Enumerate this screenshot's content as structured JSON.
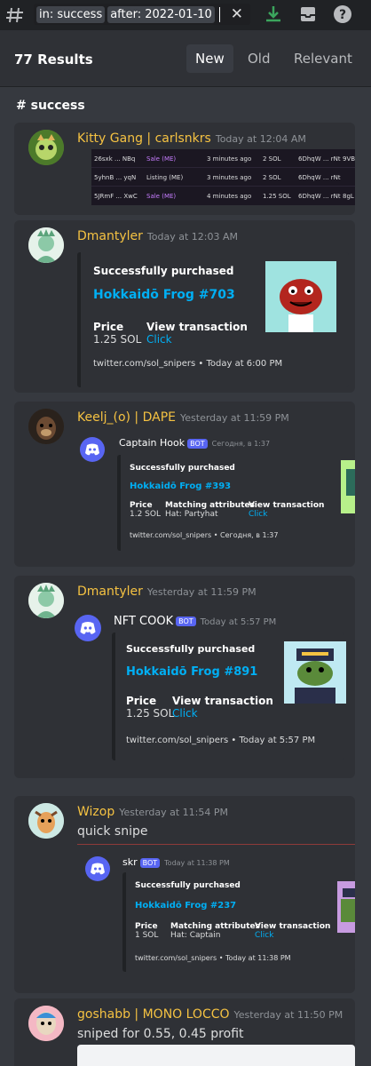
{
  "search": {
    "chip1": "in: success",
    "chip2": "after: 2022-01-10"
  },
  "header": {
    "results": "77 Results",
    "tabs": [
      "New",
      "Old",
      "Relevant"
    ]
  },
  "channel": "# success",
  "msg1": {
    "user": "Kitty Gang | carlsnkrs",
    "time": "Today at 12:04 AM",
    "rows": [
      [
        "26sxk ... NBq",
        "Sale (ME)",
        "3 minutes ago",
        "2 SOL",
        "6DhqW ... rNt",
        "9VB"
      ],
      [
        "5yhnB ... yqN",
        "Listing (ME)",
        "3 minutes ago",
        "2 SOL",
        "6DhqW ... rNt",
        ""
      ],
      [
        "5JRmF ... XwC",
        "Sale (ME)",
        "4 minutes ago",
        "1.25 SOL",
        "6DhqW ... rNt",
        "8gL"
      ]
    ]
  },
  "msg2": {
    "user": "Dmantyler",
    "time": "Today at 12:03 AM",
    "title": "Successfully purchased",
    "link": "Hokkaidō Frog #703",
    "price_label": "Price",
    "price": "1.25 SOL",
    "vt_label": "View transaction",
    "vt": "Click",
    "footer": "twitter.com/sol_snipers • Today at 6:00 PM"
  },
  "msg3": {
    "user": "Keelj_(o) | DAPE",
    "time": "Yesterday at 11:59 PM",
    "bot": "Captain Hook",
    "badge": "BOT",
    "bottime": "Сегодня, в 1:37",
    "title": "Successfully purchased",
    "link": "Hokkaidō Frog #393",
    "price_label": "Price",
    "price": "1.2 SOL",
    "attr_label": "Matching attributes",
    "attr": "Hat: Partyhat",
    "vt_label": "View transaction",
    "vt": "Click",
    "footer": "twitter.com/sol_snipers • Сегодня, в 1:37"
  },
  "msg4": {
    "user": "Dmantyler",
    "time": "Yesterday at 11:59 PM",
    "bot": "NFT COOK",
    "badge": "BOT",
    "bottime": "Today at 5:57 PM",
    "title": "Successfully purchased",
    "link": "Hokkaidō Frog #891",
    "price_label": "Price",
    "price": "1.25 SOL",
    "vt_label": "View transaction",
    "vt": "Click",
    "footer": "twitter.com/sol_snipers • Today at 5:57 PM"
  },
  "msg5": {
    "user": "Wizop",
    "time": "Yesterday at 11:54 PM",
    "text": "quick snipe",
    "bot": "skr",
    "badge": "BOT",
    "bottime": "Today at 11:38 PM",
    "title": "Successfully purchased",
    "link": "Hokkaidō Frog #237",
    "price_label": "Price",
    "price": "1 SOL",
    "attr_label": "Matching attributes",
    "attr": "Hat: Captain",
    "vt_label": "View transaction",
    "vt": "Click",
    "footer": "twitter.com/sol_snipers • Today at 11:38 PM"
  },
  "msg6": {
    "user": "goshabb | MONO LOCCO",
    "time": "Yesterday at 11:50 PM",
    "text": "sniped for 0.55, 0.45 profit"
  },
  "colors": {
    "accent": "#5865f2",
    "name": "#f5c242",
    "link": "#00aff4"
  }
}
